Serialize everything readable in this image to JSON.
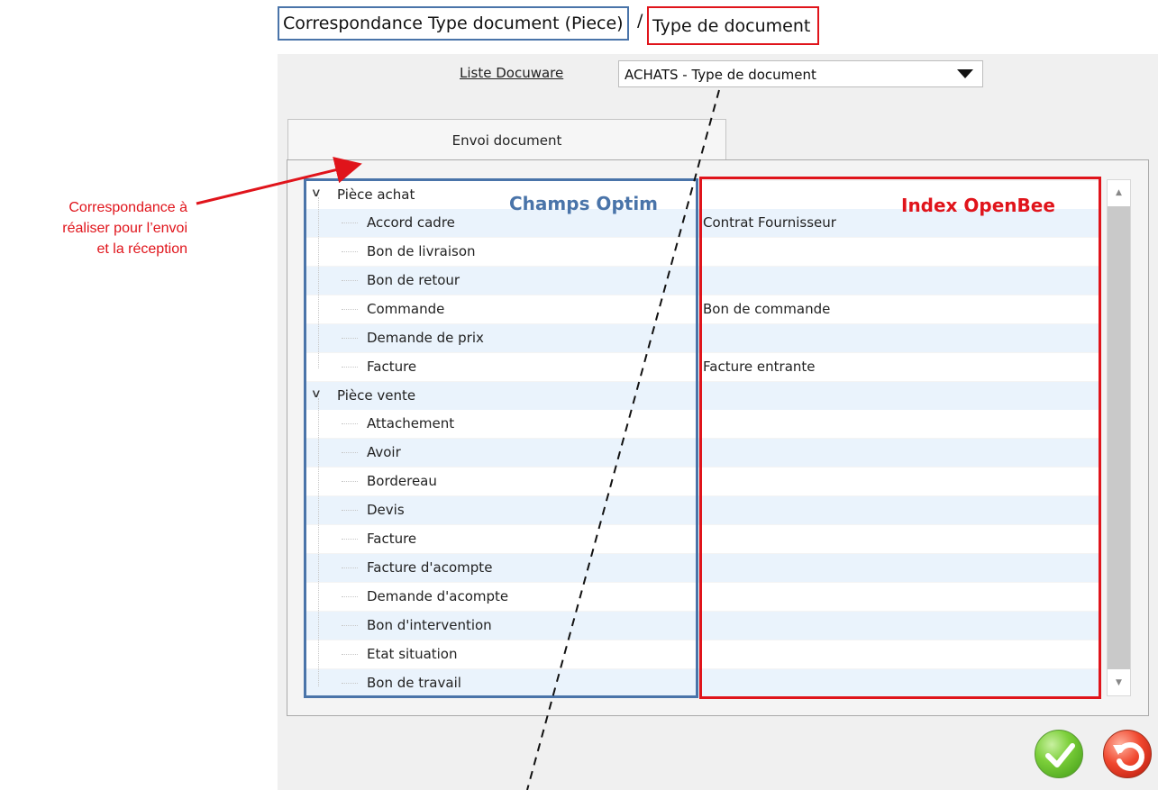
{
  "header": {
    "title_main": "Correspondance Type document (Piece)",
    "separator": "/",
    "title_sub": "Type de document"
  },
  "filter": {
    "label": "Liste Docuware",
    "selected": "ACHATS - Type de document"
  },
  "tabs": [
    {
      "label": "Envoi document",
      "active": true
    }
  ],
  "overlay": {
    "optim_label": "Champs Optim",
    "index_label": "Index OpenBee",
    "note_lines": [
      "Correspondance à",
      "réaliser pour l’envoi",
      "et la réception"
    ]
  },
  "tree": {
    "groups": [
      {
        "label": "Pièce achat",
        "items": [
          {
            "label": "Accord cadre",
            "index": "Contrat Fournisseur"
          },
          {
            "label": "Bon de livraison",
            "index": ""
          },
          {
            "label": "Bon de retour",
            "index": ""
          },
          {
            "label": "Commande",
            "index": "Bon de commande"
          },
          {
            "label": "Demande de prix",
            "index": ""
          },
          {
            "label": "Facture",
            "index": "Facture entrante"
          }
        ]
      },
      {
        "label": "Pièce vente",
        "items": [
          {
            "label": "Attachement",
            "index": ""
          },
          {
            "label": "Avoir",
            "index": ""
          },
          {
            "label": "Bordereau",
            "index": ""
          },
          {
            "label": "Devis",
            "index": ""
          },
          {
            "label": "Facture",
            "index": ""
          },
          {
            "label": "Facture d'acompte",
            "index": ""
          },
          {
            "label": "Demande d'acompte",
            "index": ""
          },
          {
            "label": "Bon d'intervention",
            "index": ""
          },
          {
            "label": "Etat situation",
            "index": ""
          },
          {
            "label": "Bon de travail",
            "index": ""
          }
        ]
      }
    ]
  },
  "icons": {
    "expand": "chevron-down-icon",
    "validate": "check-icon",
    "cancel": "undo-icon"
  },
  "colors": {
    "optim_blue": "#4a74a9",
    "openbee_red": "#e0141b",
    "row_alt": "#eaf3fc"
  }
}
